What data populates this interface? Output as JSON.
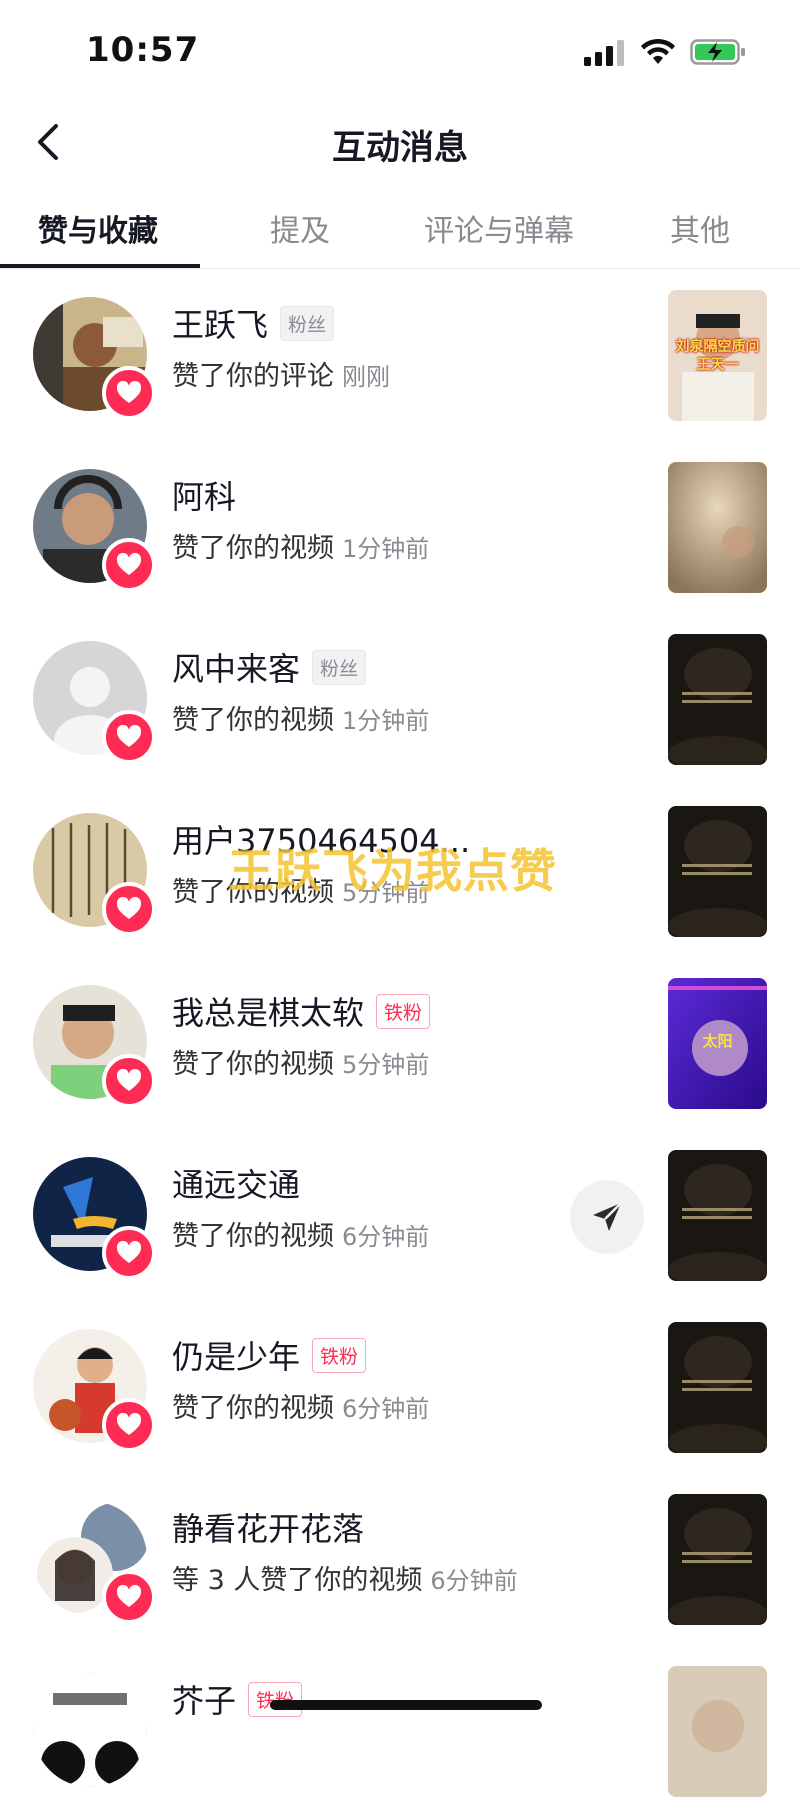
{
  "status_bar": {
    "time": "10:57"
  },
  "header": {
    "title": "互动消息"
  },
  "tabs": [
    {
      "label": "赞与收藏",
      "active": true
    },
    {
      "label": "提及",
      "active": false
    },
    {
      "label": "评论与弹幕",
      "active": false
    },
    {
      "label": "其他",
      "active": false
    }
  ],
  "notifications": [
    {
      "name": "王跃飞",
      "tag": "粉丝",
      "tag_type": "fan",
      "action": "赞了你的评论",
      "time": "刚刚",
      "thumb_caption": "刘泉隔空质问\n王天一"
    },
    {
      "name": "阿科",
      "tag": "",
      "tag_type": "",
      "action": "赞了你的视频",
      "time": "1分钟前",
      "thumb_caption": ""
    },
    {
      "name": "风中来客",
      "tag": "粉丝",
      "tag_type": "fan",
      "action": "赞了你的视频",
      "time": "1分钟前",
      "thumb_caption": ""
    },
    {
      "name": "用户3750464504...",
      "tag": "",
      "tag_type": "",
      "action": "赞了你的视频",
      "time": "5分钟前",
      "thumb_caption": ""
    },
    {
      "name": "我总是棋太软",
      "tag": "铁粉",
      "tag_type": "iron",
      "action": "赞了你的视频",
      "time": "5分钟前",
      "thumb_caption": "太阳"
    },
    {
      "name": "通远交通",
      "tag": "",
      "tag_type": "",
      "action": "赞了你的视频",
      "time": "6分钟前",
      "thumb_caption": ""
    },
    {
      "name": "仍是少年",
      "tag": "铁粉",
      "tag_type": "iron",
      "action": "赞了你的视频",
      "time": "6分钟前",
      "thumb_caption": ""
    },
    {
      "name": "静看花开花落",
      "tag": "",
      "tag_type": "",
      "action": "等 3 人赞了你的视频",
      "time": "6分钟前",
      "thumb_caption": ""
    },
    {
      "name": "芥子",
      "tag": "铁粉",
      "tag_type": "iron",
      "action": "",
      "time": "",
      "thumb_caption": ""
    }
  ],
  "overlay": {
    "text": "王跃飞为我点赞"
  },
  "colors": {
    "accent": "#fe2c55",
    "text_primary": "#161823",
    "text_secondary": "#8a8b91",
    "overlay": "#f4c430"
  }
}
